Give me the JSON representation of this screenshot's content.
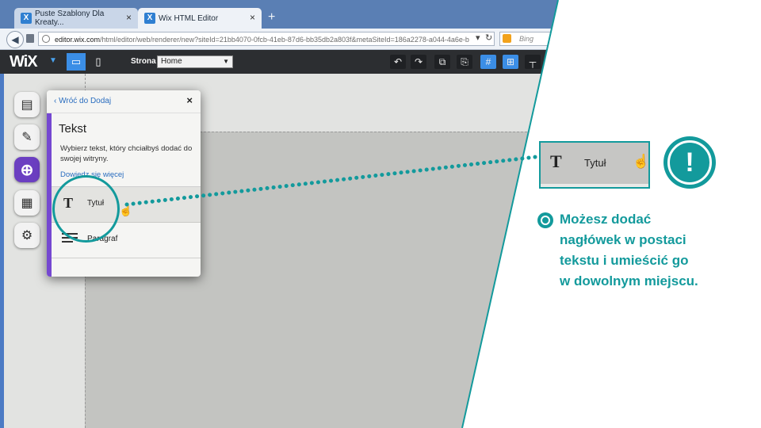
{
  "browser": {
    "tabs": [
      {
        "label": "Puste Szablony Dla Kreaty...",
        "close": "×"
      },
      {
        "label": "Wix HTML Editor",
        "close": "×"
      }
    ],
    "new_tab": "+",
    "url_domain": "editor.wix.com",
    "url_rest": "/html/editor/web/renderer/new?siteId=21bb4070-0fcb-41eb-87d6-bb35db2a803f&metaSiteId=186a2278-a044-4a6e-b",
    "search_placeholder": "Bing"
  },
  "wix_bar": {
    "logo": "WiX",
    "page_label": "Strona",
    "page_value": "Home"
  },
  "add_panel": {
    "back_label": "Wróć do Dodaj",
    "close": "×",
    "title": "Tekst",
    "description": "Wybierz tekst, który chciałbyś dodać do swojej witryny.",
    "more_link": "Dowiedz się więcej",
    "items": [
      {
        "label": "Tytuł"
      },
      {
        "label": "Paragraf"
      }
    ]
  },
  "callout": {
    "preview_label": "Tytuł",
    "lines": [
      "Możesz dodać",
      "nagłówek w postaci",
      "tekstu i umieścić go",
      "w dowolnym miejscu."
    ]
  },
  "colors": {
    "accent_teal": "#139a9c",
    "panel_purple": "#7548d1",
    "wix_bar": "#2c2e31"
  }
}
